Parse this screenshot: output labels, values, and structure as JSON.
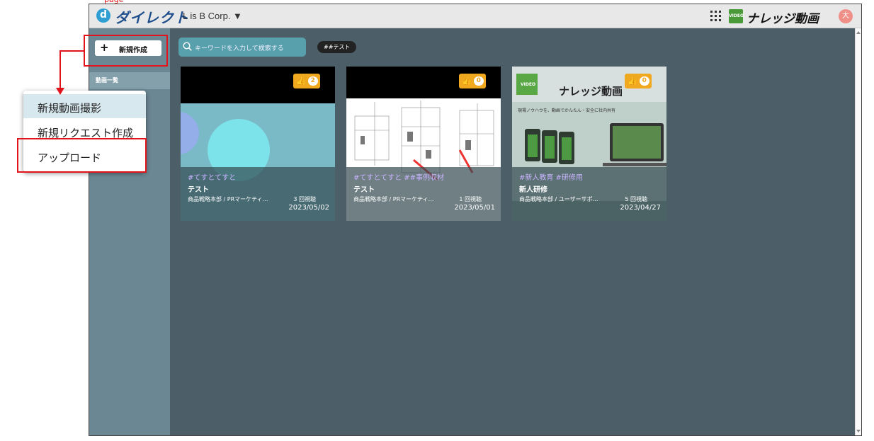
{
  "top_note": "page",
  "header": {
    "logo_letter": "d",
    "logo_text": "ダイレクト",
    "org_name": "L is B Corp. ▼",
    "kv_badge": "VIDEO",
    "kv_title": "ナレッジ動画",
    "avatar_initial": "大"
  },
  "sidebar": {
    "new_button_plus": "+",
    "new_button_label": "新規作成",
    "items": [
      {
        "label": "動画一覧"
      }
    ]
  },
  "search": {
    "placeholder": "キーワードを入力して検索する"
  },
  "tag_filter": "##テスト",
  "videos": [
    {
      "likes": "2",
      "tags": "#てすとてすと",
      "title": "テスト",
      "dept": "商品戦略本部 / PRマーケティ…",
      "views": "3 回視聴",
      "date": "2023/05/02"
    },
    {
      "likes": "0",
      "tags": "#てすとてすと ##事例収材",
      "title": "テスト",
      "dept": "商品戦略本部 / PRマーケティ…",
      "views": "1 回視聴",
      "date": "2023/05/01"
    },
    {
      "likes": "0",
      "tags": "#新人教育 #研修用",
      "title": "新人研修",
      "dept": "商品戦略本部 / ユーザーサポ…",
      "views": "5 回視聴",
      "date": "2023/04/27",
      "thumb_title": "ナレッジ動画",
      "thumb_sub": "現場ノウハウを、動画でかんたん・安全に社内共有",
      "thumb_badge": "VIDEO"
    }
  ],
  "popup_menu": {
    "items": [
      {
        "label": "新規動画撮影"
      },
      {
        "label": "新規リクエスト作成"
      },
      {
        "label": "アップロード"
      }
    ]
  },
  "colors": {
    "annotation_red": "#e1141c",
    "like_orange": "#f0a81f",
    "sidebar": "#6b8793",
    "main_bg": "#4c5f69"
  }
}
